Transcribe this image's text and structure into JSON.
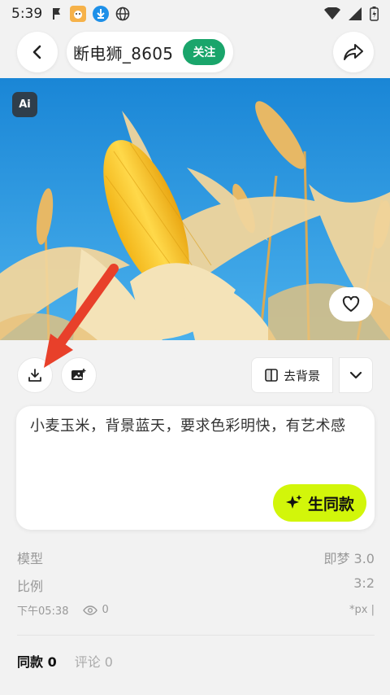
{
  "status_bar": {
    "time": "5:39"
  },
  "header": {
    "username": "断电狮_8605",
    "follow_label": "关注"
  },
  "hero": {
    "ai_badge": "Ai"
  },
  "toolbar": {
    "remove_bg_label": "去背景"
  },
  "prompt": {
    "text": "小麦玉米，背景蓝天，要求色彩明快，有艺术感",
    "generate_label": "生同款"
  },
  "meta": {
    "model_label": "模型",
    "model_value": "即梦 3.0",
    "ratio_label": "比例",
    "ratio_value": "3:2",
    "time": "下午05:38",
    "views": "0",
    "unit": "*px |"
  },
  "tabs": [
    {
      "label": "同款 0"
    },
    {
      "label": "评论 0"
    }
  ],
  "colors": {
    "follow": "#1aa56b",
    "generate": "#d2f60a",
    "arrow": "#e8402a",
    "sky": "#1f90d8"
  },
  "icons": [
    "back-arrow-icon",
    "share-icon",
    "heart-icon",
    "download-icon",
    "image-edit-icon",
    "remove-bg-icon",
    "chevron-down-icon",
    "sparkle-icon",
    "eye-icon"
  ]
}
